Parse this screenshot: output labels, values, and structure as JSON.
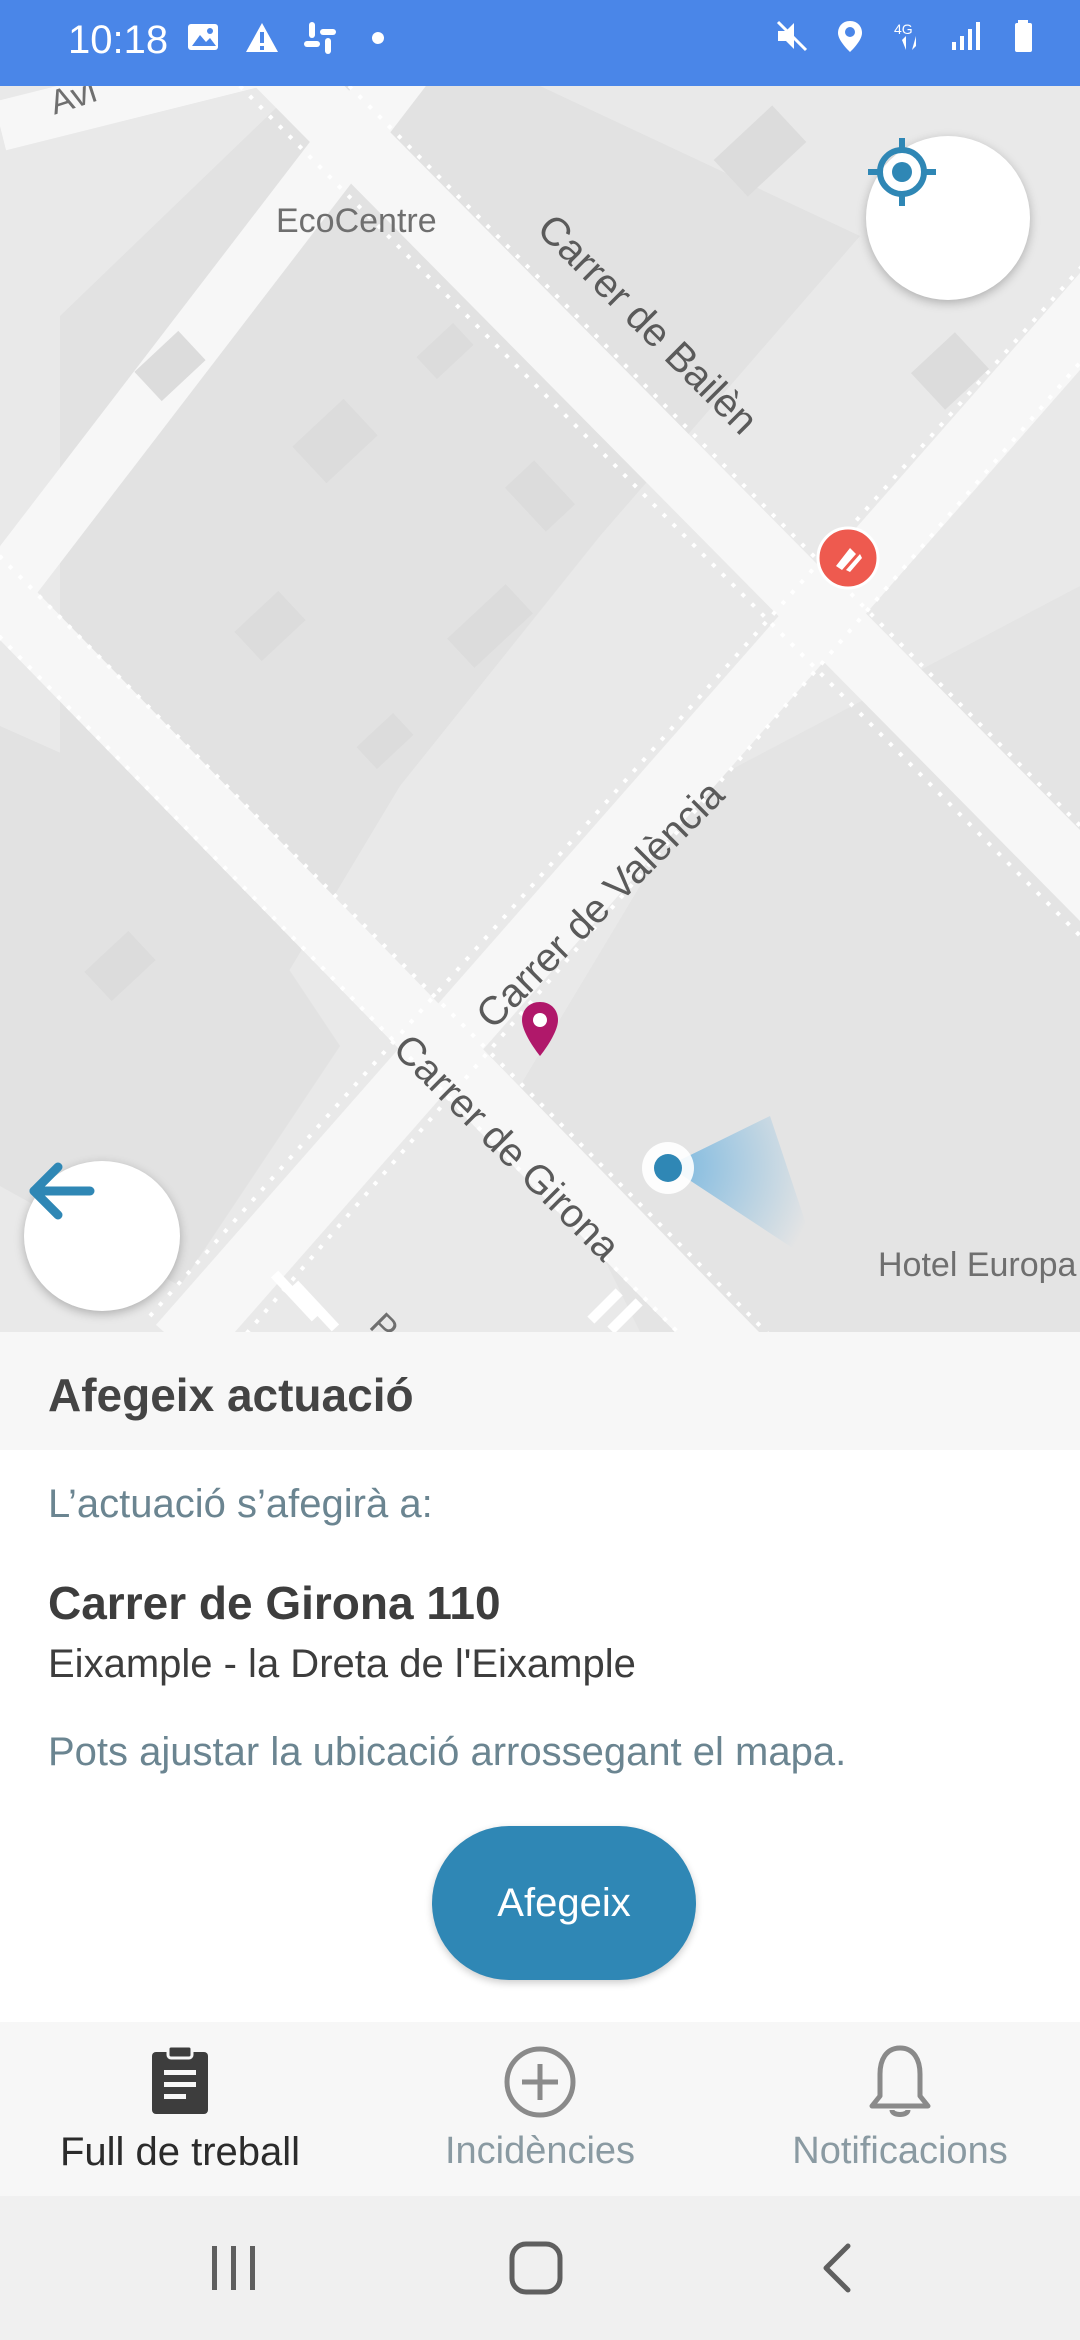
{
  "status_bar": {
    "time": "10:18",
    "network": "4G",
    "icons_left": [
      "image-icon",
      "warning-icon",
      "slack-icon",
      "dot-icon"
    ],
    "icons_right": [
      "mute-icon",
      "location-icon",
      "network-4g-icon",
      "signal-icon",
      "battery-icon"
    ],
    "background": "#4a86e8"
  },
  "map": {
    "places": {
      "ecocentre": "EcoCentre",
      "hotel": "Hotel Europa",
      "top_fragment": "Avi",
      "bottom_fragment": "P"
    },
    "streets": {
      "bailen": "Carrer de Bailèn",
      "valencia": "Carrer de València",
      "girona": "Carrer de Girona"
    },
    "markers": [
      "location-pin-icon",
      "user-location-dot-icon",
      "restaurant-icon"
    ],
    "buttons": {
      "locate": "crosshair-icon",
      "back": "arrow-left-icon"
    }
  },
  "panel": {
    "title": "Afegeix actuació",
    "intro": "L’actuació s’afegirà a:",
    "address": "Carrer de Girona 110",
    "district": "Eixample - la Dreta de l'Eixample",
    "hint": "Pots ajustar la ubicació arrossegant el mapa.",
    "button_label": "Afegeix",
    "accent": "#2f87b5"
  },
  "bottom_nav": {
    "items": [
      {
        "label": "Full de treball",
        "icon": "clipboard-icon",
        "active": true
      },
      {
        "label": "Incidències",
        "icon": "plus-circle-icon",
        "active": false
      },
      {
        "label": "Notificacions",
        "icon": "bell-icon",
        "active": false
      }
    ]
  },
  "system_nav": {
    "items": [
      "recent-apps-icon",
      "home-icon",
      "back-icon"
    ]
  }
}
